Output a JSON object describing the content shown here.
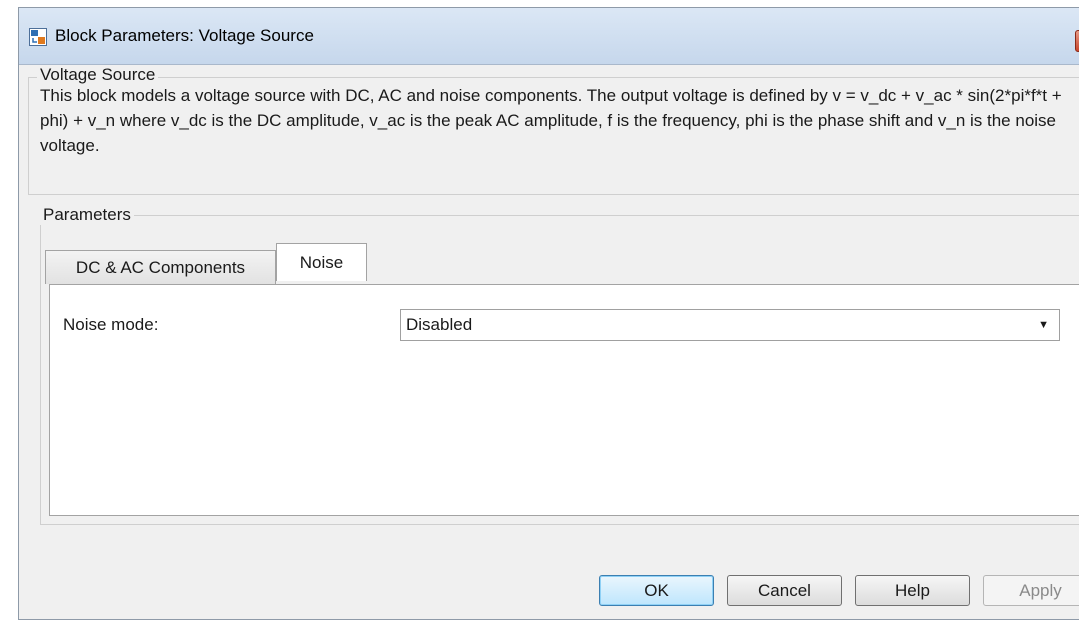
{
  "window": {
    "title": "Block Parameters: Voltage Source",
    "close_glyph": "✕"
  },
  "description_group": {
    "label": "Voltage Source",
    "text": "This block models a voltage source with DC, AC and noise components. The output voltage is defined by v = v_dc + v_ac * sin(2*pi*f*t + phi) + v_n where v_dc is the DC amplitude, v_ac is the peak AC amplitude, f is the frequency, phi is the phase shift and v_n is the noise voltage."
  },
  "parameters_group": {
    "label": "Parameters",
    "tabs": [
      {
        "label": "DC & AC Components",
        "active": false
      },
      {
        "label": "Noise",
        "active": true
      }
    ],
    "noise_mode": {
      "label": "Noise mode:",
      "value": "Disabled",
      "arrow": "▼"
    }
  },
  "buttons": {
    "ok": "OK",
    "cancel": "Cancel",
    "help": "Help",
    "apply": "Apply"
  },
  "icons": {
    "title_icon": "simulink-block-icon",
    "close": "close-icon",
    "dropdown": "chevron-down-icon"
  }
}
